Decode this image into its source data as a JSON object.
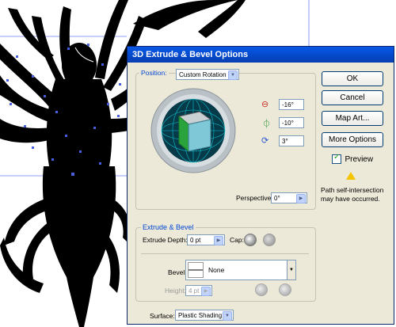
{
  "dialog": {
    "title": "3D Extrude & Bevel Options",
    "position_label": "Position:",
    "position_value": "Custom Rotation",
    "rotations": [
      {
        "icon": "x-axis-rotation-icon",
        "value": "-16°"
      },
      {
        "icon": "y-axis-rotation-icon",
        "value": "-10°"
      },
      {
        "icon": "z-axis-rotation-icon",
        "value": "3°"
      }
    ],
    "perspective_label": "Perspective:",
    "perspective_value": "0°",
    "extrude_group": "Extrude & Bevel",
    "extrude_depth_label": "Extrude Depth:",
    "extrude_depth_value": "0 pt",
    "cap_label": "Cap:",
    "bevel_label": "Bevel:",
    "bevel_value": "None",
    "height_label": "Height:",
    "height_value": "4 pt",
    "surface_label": "Surface:",
    "surface_value": "Plastic Shading",
    "buttons": {
      "ok": "OK",
      "cancel": "Cancel",
      "map_art": "Map Art...",
      "more_options": "More Options"
    },
    "preview_label": "Preview",
    "preview_checked": true,
    "warning_text_1": "Path self-intersection",
    "warning_text_2": "may have occurred.",
    "colors": {
      "title_bar": "#0a58e6",
      "dialog_bg": "#ece9d8",
      "cube_face": "#7fc8d8",
      "sphere_bg": "#053a48",
      "selection": "#4a5fe0"
    }
  }
}
